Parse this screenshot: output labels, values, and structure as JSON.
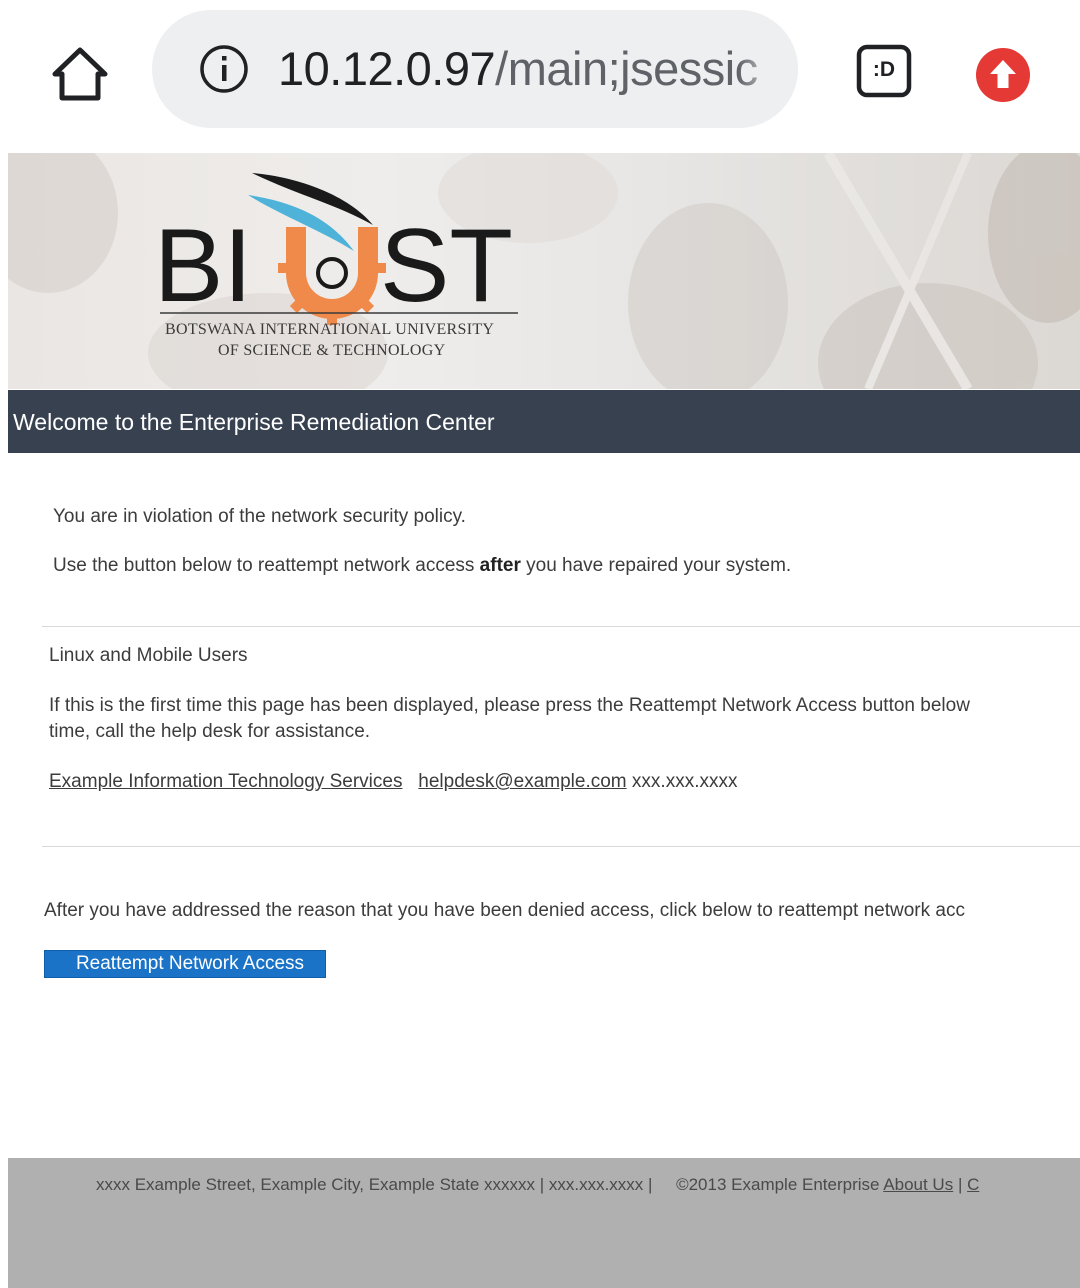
{
  "browser": {
    "url_host": "10.12.0.97",
    "url_path": "/main;jsessic",
    "tab_switcher_label": ":D",
    "icons": [
      "home-icon",
      "info-icon",
      "tab-switcher-icon",
      "upload-icon"
    ],
    "accent_red": "#e53935"
  },
  "banner": {
    "logo_letters_left": "BI",
    "logo_letters_right": "ST",
    "logo_line1": "Botswana International University",
    "logo_line2": "of Science & Technology"
  },
  "header": {
    "title": "Welcome to the Enterprise Remediation Center",
    "bg_color": "#374150"
  },
  "main": {
    "violation_text": "You are in violation of the network security policy.",
    "instruction_pre": "Use the button below to reattempt network access ",
    "instruction_bold": "after",
    "instruction_post": " you have repaired your system.",
    "section_title": "Linux and Mobile Users",
    "section_line1": "If this is the first time this page has been displayed, please press the Reattempt Network Access button below",
    "section_line2": "time, call the help desk for assistance.",
    "contact_link_org": "Example Information Technology Services",
    "contact_link_email": "helpdesk@example.com",
    "contact_phone": "xxx.xxx.xxxx",
    "after_text": "After you have addressed the reason that you have been denied access, click below to reattempt network acc",
    "reattempt_button": "Reattempt Network Access",
    "button_color": "#1a73c6"
  },
  "footer": {
    "address": "xxxx Example Street, Example City, Example State xxxxxx | xxx.xxx.xxxx |",
    "copyright": "©2013 Example Enterprise ",
    "about_link": "About Us",
    "separator": " | ",
    "contact_link_partial": "C"
  }
}
